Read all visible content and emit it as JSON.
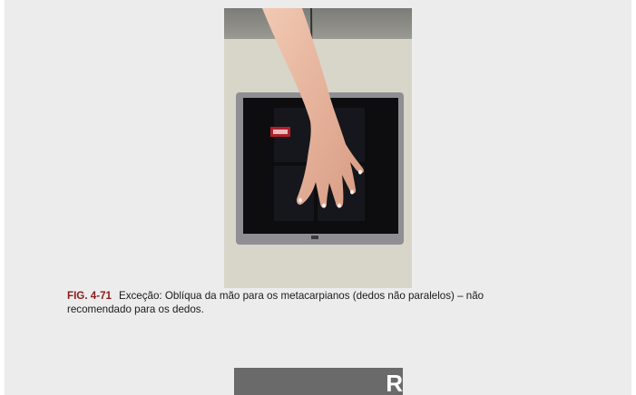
{
  "figure": {
    "label": "FIG. 4-71",
    "caption_line1": "Exceção: Oblíqua da mão para os metacarpianos (dedos não paralelos) – não",
    "caption_line2": "recomendado para os dedos.",
    "photo_icon": "hand-on-detector-photo"
  },
  "next_figure": {
    "partial_letter": "R"
  }
}
